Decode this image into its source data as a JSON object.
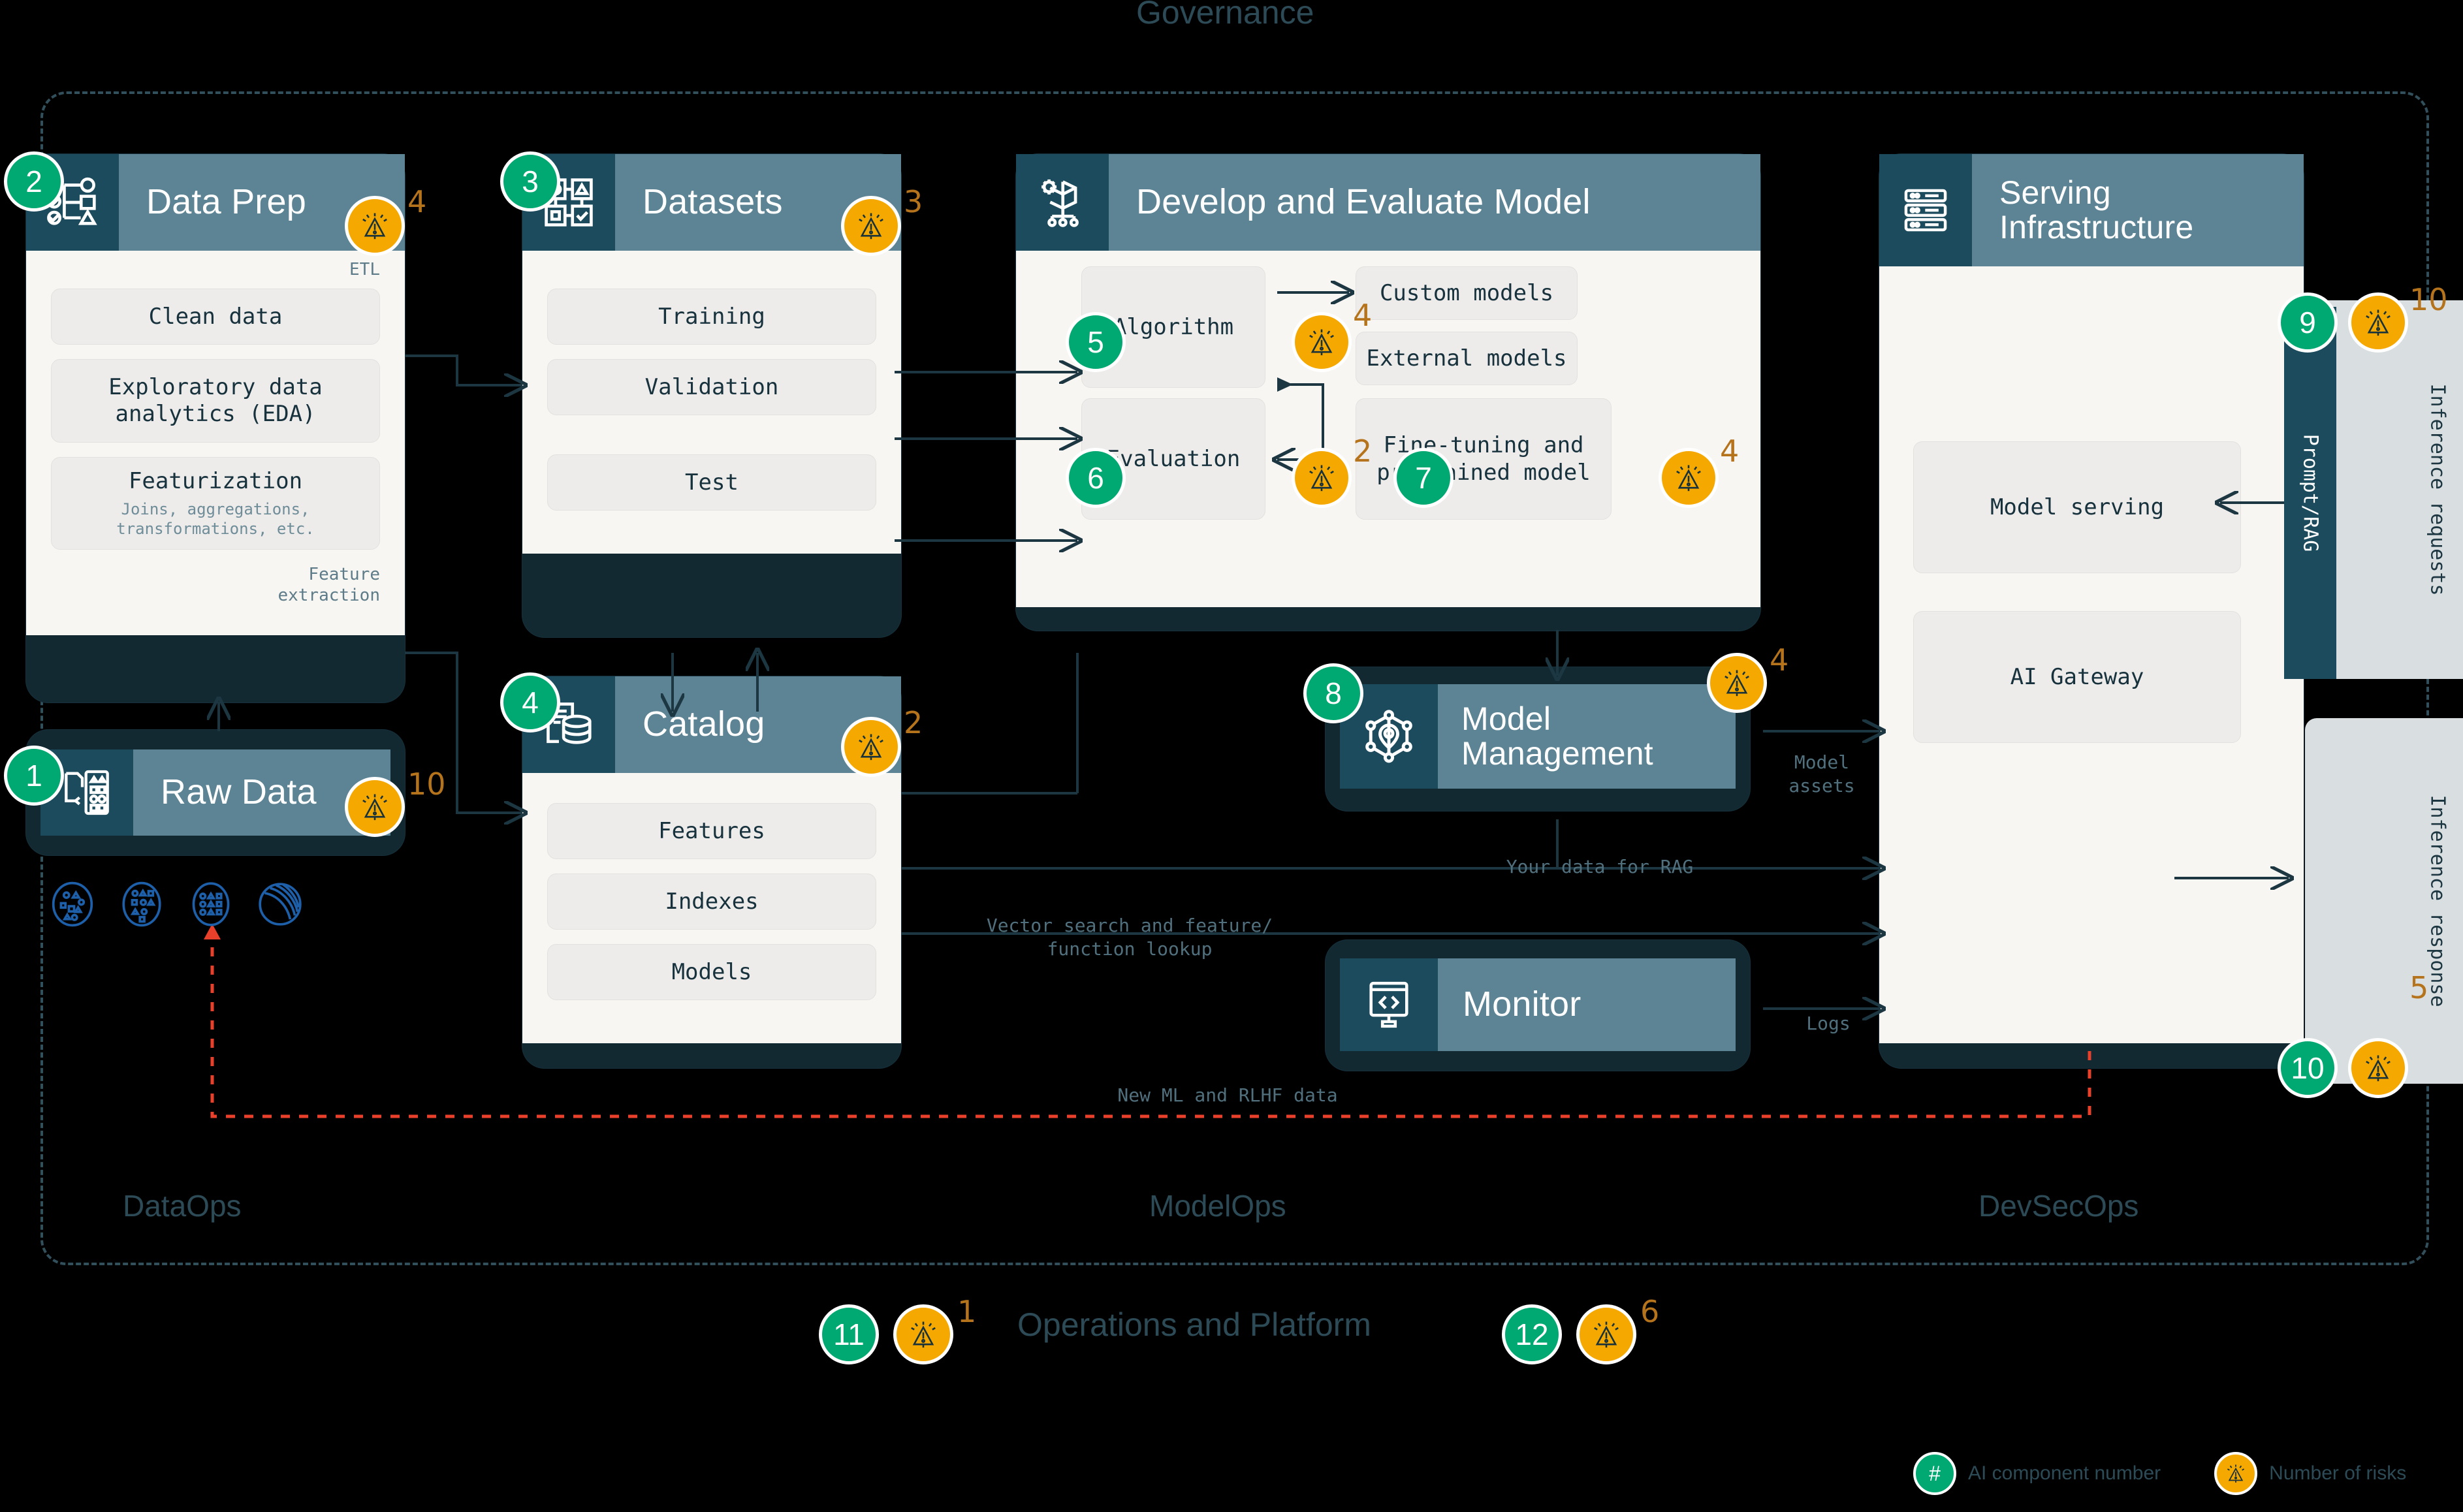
{
  "diagram": {
    "governance_title": "Governance",
    "zones": [
      {
        "id": "dataops",
        "label": "DataOps"
      },
      {
        "id": "modelops",
        "label": "ModelOps"
      },
      {
        "id": "devsecops",
        "label": "DevSecOps"
      }
    ],
    "ops_platform_label": "Operations and Platform"
  },
  "cards": {
    "raw_data": {
      "title": "Raw Data",
      "icon": "document-shapes-icon",
      "component_number": "1",
      "risk_count": "10"
    },
    "data_prep": {
      "title": "Data Prep",
      "icon": "checklist-flow-icon",
      "component_number": "2",
      "risk_count": "4",
      "top_label": "ETL",
      "bottom_label_line1": "Feature",
      "bottom_label_line2": "extraction",
      "items": [
        {
          "label": "Clean data",
          "sub": ""
        },
        {
          "label": "Exploratory data analytics (EDA)",
          "sub": ""
        },
        {
          "label": "Featurization",
          "sub": "Joins, aggregations, transformations, etc."
        }
      ]
    },
    "datasets": {
      "title": "Datasets",
      "icon": "grid-shapes-icon",
      "component_number": "3",
      "risk_count": "3",
      "items": [
        "Training",
        "Validation",
        "Test"
      ]
    },
    "catalog": {
      "title": "Catalog",
      "icon": "database-document-icon",
      "component_number": "4",
      "risk_count": "2",
      "items": [
        "Features",
        "Indexes",
        "Models"
      ]
    },
    "develop_evaluate": {
      "title": "Develop and Evaluate Model",
      "icon": "gear-network-icon",
      "algorithm": {
        "label": "Algorithm",
        "component_number": "5",
        "risk_count": "4"
      },
      "evaluation": {
        "label": "Evaluation",
        "component_number": "6",
        "risk_count": "2"
      },
      "fine_tuning": {
        "label": "Fine-tuning and pretrained model",
        "component_number": "7",
        "risk_count": "4"
      },
      "custom_models": "Custom models",
      "external_models": "External models"
    },
    "model_management": {
      "title": "Model Management",
      "icon": "model-node-icon",
      "component_number": "8",
      "risk_count": "4"
    },
    "monitor": {
      "title": "Monitor",
      "icon": "code-monitor-icon"
    },
    "serving_infrastructure": {
      "title": "Serving Infrastructure",
      "icon": "server-rack-icon",
      "items": [
        "Model serving",
        "AI Gateway"
      ]
    }
  },
  "strips": {
    "prompt_rag": {
      "label": "Prompt/RAG",
      "component_number": "9",
      "risk_count": "10"
    },
    "inference_requests": {
      "label": "Inference requests"
    },
    "inference_response": {
      "label": "Inference response",
      "component_number": "10",
      "risk_count": "5"
    }
  },
  "ops_badges": [
    {
      "component_number": "11",
      "risk_count": "1"
    },
    {
      "component_number": "12",
      "risk_count": "6"
    }
  ],
  "wire_labels": {
    "model_assets": "Model\nassets",
    "your_data_rag": "Your data for RAG",
    "vector_search": "Vector search and feature/\nfunction lookup",
    "logs": "Logs",
    "new_ml_rlhf": "New ML and RLHF data"
  },
  "legend": {
    "component_symbol": "#",
    "component_text": "AI component number",
    "risk_text": "Number of risks"
  },
  "colors": {
    "green": "#00a972",
    "amber": "#f5a800",
    "header_dark": "#1b4b5c",
    "header_light": "#5d8494",
    "card_bg": "#122932",
    "panel_bg": "#f7f6f2",
    "ink": "#2d4b57",
    "red_dashed": "#e8402a"
  }
}
